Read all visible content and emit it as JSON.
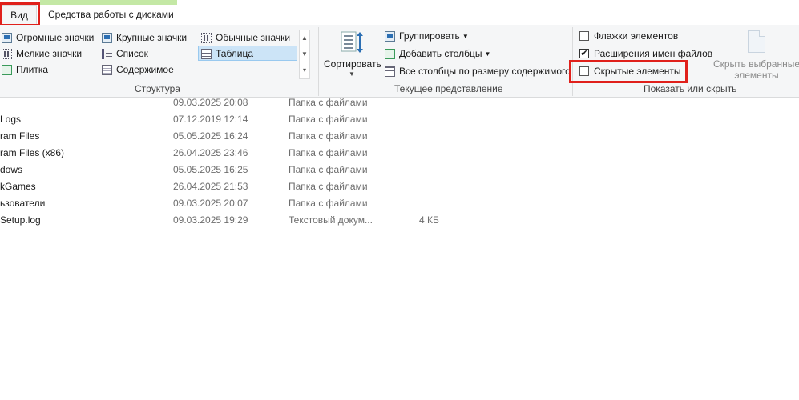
{
  "tabs": {
    "view": "Вид",
    "disk_tools": "Средства работы с дисками"
  },
  "layout_group": {
    "label": "Структура",
    "items": {
      "huge_icons": "Огромные значки",
      "large_icons": "Крупные значки",
      "medium_icons": "Обычные значки",
      "small_icons": "Мелкие значки",
      "list": "Список",
      "details": "Таблица",
      "tiles": "Плитка",
      "content": "Содержимое"
    },
    "selected": "Таблица"
  },
  "current_view_group": {
    "label": "Текущее представление",
    "sort_by": "Сортировать",
    "group_by": "Группировать",
    "add_columns": "Добавить столбцы",
    "size_all_columns": "Все столбцы по размеру содержимого"
  },
  "show_hide_group": {
    "label": "Показать или скрыть",
    "item_checkboxes": {
      "label": "Флажки элементов",
      "checked": false
    },
    "file_name_extensions": {
      "label": "Расширения имен файлов",
      "checked": true
    },
    "hidden_items": {
      "label": "Скрытые элементы",
      "checked": false
    },
    "hide_selected_line1": "Скрыть выбранные",
    "hide_selected_line2": "элементы"
  },
  "files": [
    {
      "name": "",
      "date": "09.03.2025 20:08",
      "type": "Папка с файлами",
      "size": ""
    },
    {
      "name": "Logs",
      "date": "07.12.2019 12:14",
      "type": "Папка с файлами",
      "size": ""
    },
    {
      "name": "ram Files",
      "date": "05.05.2025 16:24",
      "type": "Папка с файлами",
      "size": ""
    },
    {
      "name": "ram Files (x86)",
      "date": "26.04.2025 23:46",
      "type": "Папка с файлами",
      "size": ""
    },
    {
      "name": "dows",
      "date": "05.05.2025 16:25",
      "type": "Папка с файлами",
      "size": ""
    },
    {
      "name": "kGames",
      "date": "26.04.2025 21:53",
      "type": "Папка с файлами",
      "size": ""
    },
    {
      "name": "ьзователи",
      "date": "09.03.2025 20:07",
      "type": "Папка с файлами",
      "size": ""
    },
    {
      "name": "Setup.log",
      "date": "09.03.2025 19:29",
      "type": "Текстовый докум...",
      "size": "4 КБ"
    }
  ],
  "colors": {
    "highlight": "#e0201b",
    "selected_bg": "#cce4f7",
    "tab_accent": "#c4e8a5"
  }
}
